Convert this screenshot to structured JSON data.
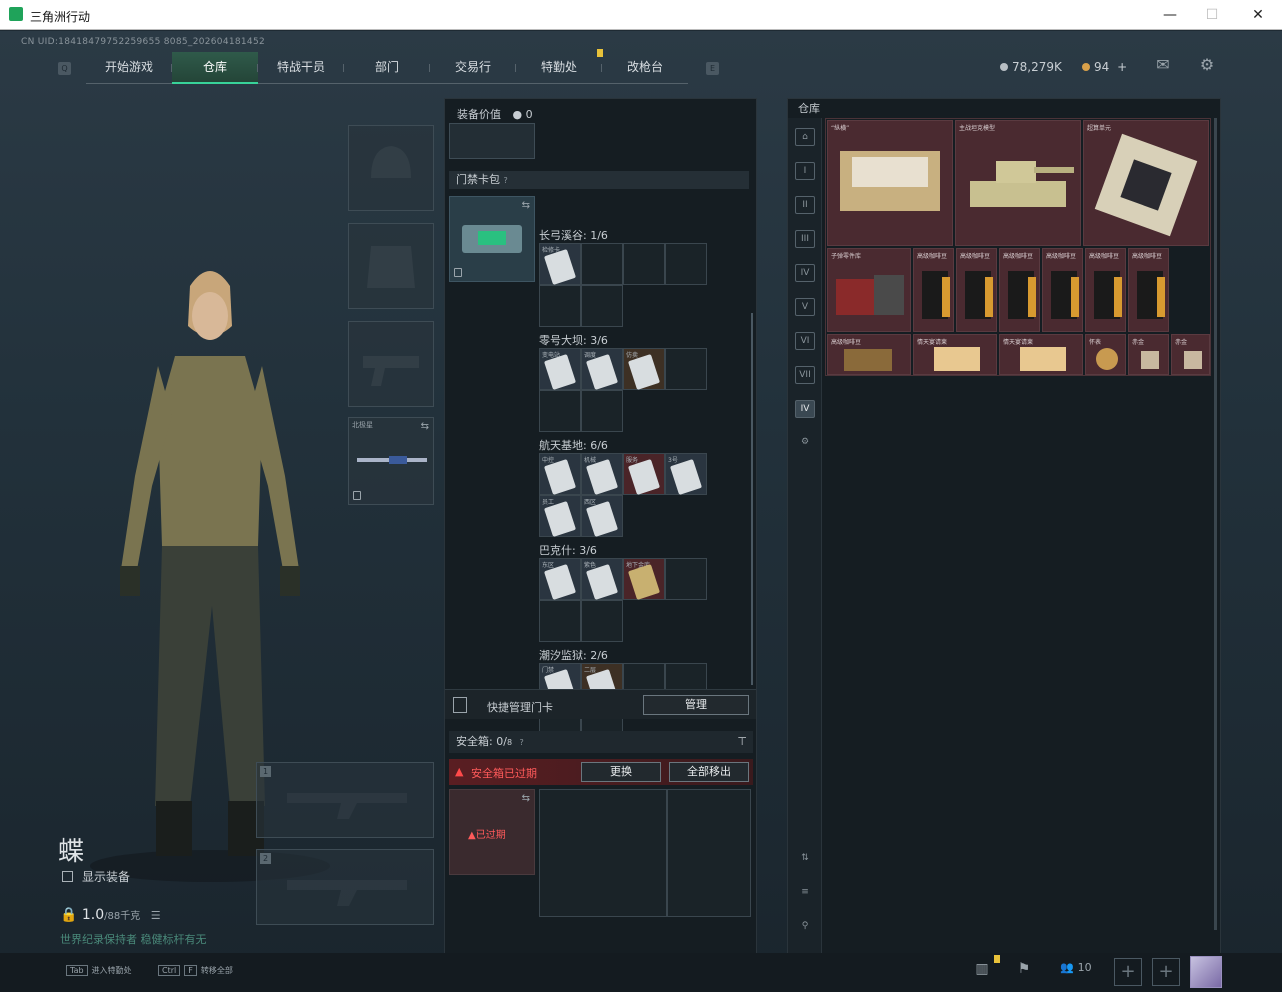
{
  "window": {
    "title": "三角洲行动"
  },
  "uid": "CN UID:18418479752259655 8085_202604181452",
  "nav": {
    "tabs": [
      "开始游戏",
      "仓库",
      "特战干员",
      "部门",
      "交易行",
      "特勤处",
      "改枪台"
    ],
    "active_tab": "仓库"
  },
  "currency": {
    "primary": "78,279K",
    "secondary": "94"
  },
  "character": {
    "name": "蝶",
    "show_equipment_label": "显示装备",
    "weight_value": "1.0",
    "weight_max": "/88千克",
    "warning_text": "世界纪录保持者 稳健标杆有无"
  },
  "equipment": {
    "knife_slot_label": "北极星",
    "weapon_slots": [
      "1",
      "2"
    ]
  },
  "center": {
    "equip_value_label": "装备价值",
    "equip_value": "0",
    "card_pack_label": "门禁卡包",
    "maps": [
      {
        "name": "长弓溪谷: 1/6",
        "items": [
          {
            "label": "检修卡",
            "style": "item"
          }
        ]
      },
      {
        "name": "零号大坝: 3/6",
        "items": [
          {
            "label": "变电站",
            "style": "item"
          },
          {
            "label": "调度",
            "style": "item"
          },
          {
            "label": "仿卖",
            "style": "brown"
          }
        ]
      },
      {
        "name": "航天基地: 6/6",
        "items": [
          {
            "label": "中控",
            "style": "item"
          },
          {
            "label": "机械",
            "style": "item"
          },
          {
            "label": "服务",
            "style": "red"
          },
          {
            "label": "3号",
            "style": "item"
          },
          {
            "label": "员工",
            "style": "item"
          },
          {
            "label": "西区",
            "style": "item"
          }
        ]
      },
      {
        "name": "巴克什: 3/6",
        "items": [
          {
            "label": "东区",
            "style": "item"
          },
          {
            "label": "紫色",
            "style": "item"
          },
          {
            "label": "地下金库",
            "style": "red"
          }
        ]
      },
      {
        "name": "潮汐监狱: 2/6",
        "items": [
          {
            "label": "门禁",
            "style": "item"
          },
          {
            "label": "二层",
            "style": "brown"
          }
        ]
      }
    ],
    "quick_manage_label": "快捷管理门卡",
    "manage_button": "管理",
    "safe_box_label": "安全箱:",
    "safe_box_count": "0/",
    "safe_box_capacity": "8",
    "expired_text": "安全箱已过期",
    "replace_button": "更换",
    "move_all_button": "全部移出",
    "expired_badge": "已过期"
  },
  "stash": {
    "title": "仓库",
    "top_items": [
      {
        "label": "“纵横”"
      },
      {
        "label": "主战坦克模型"
      },
      {
        "label": "超算单元"
      }
    ],
    "mid_items": [
      {
        "label": "子弹零件库"
      },
      {
        "label": "高级咖啡豆"
      },
      {
        "label": "高级咖啡豆"
      },
      {
        "label": "高级咖啡豆"
      },
      {
        "label": "高级咖啡豆"
      },
      {
        "label": "高级咖啡豆"
      },
      {
        "label": "高级咖啡豆"
      }
    ],
    "bottom_items": [
      {
        "label": "高级咖啡豆"
      },
      {
        "label": "情天宴请柬"
      },
      {
        "label": "情天宴请柬"
      },
      {
        "label": "怀表"
      },
      {
        "label": "赤金"
      },
      {
        "label": "赤金"
      }
    ]
  },
  "bottom_bar": {
    "hint1_key": "Tab",
    "hint1_label": "进入特勤处",
    "hint2_key1": "Ctrl",
    "hint2_key2": "F",
    "hint2_label": "转移全部",
    "friends_count": "10"
  }
}
